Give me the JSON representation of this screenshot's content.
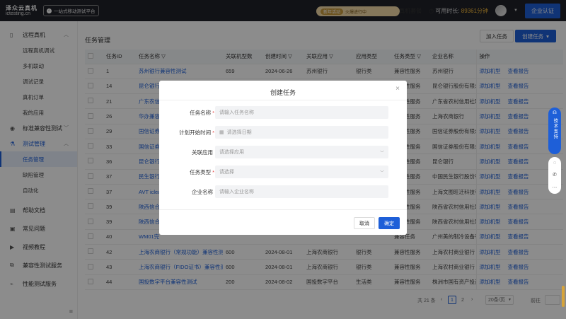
{
  "topbar": {
    "logo_line1": "泽众云真机",
    "logo_line2": "ictesting.cn",
    "slogan": "一站式移动测试平台",
    "promo_tag": "新年活动",
    "promo_text": "火爆进行中",
    "real_device_cloud": "真机套餐",
    "duration_label": "可用时长:",
    "duration_value": "89361分钟",
    "enterprise_cert": "企业认证"
  },
  "sidebar": {
    "groups": [
      {
        "label": "远程真机",
        "items": [
          "远程真机调试",
          "多机联动",
          "调试记录",
          "真机订单",
          "我的应用"
        ]
      },
      {
        "label": "标准兼容性测试"
      },
      {
        "label": "测试管理",
        "items": [
          "任务管理",
          "缺陷管理",
          "自动化"
        ]
      },
      {
        "label": "帮助文档"
      },
      {
        "label": "常见问题"
      },
      {
        "label": "视频教程"
      },
      {
        "label": "兼容性测试服务"
      },
      {
        "label": "性能测试服务"
      }
    ]
  },
  "main": {
    "title": "任务管理",
    "add_task": "加入任务",
    "create_task": "创建任务",
    "columns": [
      "任务ID",
      "任务名称",
      "关联机型数",
      "创建时间",
      "关联应用",
      "应用类型",
      "任务类型",
      "企业名称",
      "操作"
    ],
    "op_add": "添加机型",
    "op_view": "查看报告",
    "rows": [
      {
        "id": "1",
        "name": "苏州银行兼容性测试",
        "count": "659",
        "date": "2024-06-26",
        "app": "苏州银行",
        "apptype": "银行类",
        "tasktype": "兼容性服务",
        "company": "苏州银行"
      },
      {
        "id": "14",
        "name": "昆仑银行",
        "count": "",
        "date": "",
        "app": "",
        "apptype": "",
        "tasktype": "兼容性服务",
        "company": "昆仑银行股份有限公"
      },
      {
        "id": "21",
        "name": "广东农信",
        "count": "",
        "date": "",
        "app": "",
        "apptype": "",
        "tasktype": "兼容性服务",
        "company": "广东省农村信用社联"
      },
      {
        "id": "26",
        "name": "华办兼容性",
        "count": "",
        "date": "",
        "app": "",
        "apptype": "",
        "tasktype": "兼容性服务",
        "company": "上海农商银行"
      },
      {
        "id": "29",
        "name": "国信证券",
        "count": "",
        "date": "",
        "app": "",
        "apptype": "",
        "tasktype": "兼容性服务",
        "company": "国信证券股份有限公"
      },
      {
        "id": "33",
        "name": "国信证券",
        "count": "",
        "date": "",
        "app": "",
        "apptype": "",
        "tasktype": "兼容性服务",
        "company": "国信证券股份有限公"
      },
      {
        "id": "36",
        "name": "昆仑银行",
        "count": "",
        "date": "",
        "app": "",
        "apptype": "",
        "tasktype": "兼容性服务",
        "company": "昆仑银行"
      },
      {
        "id": "37",
        "name": "民生银行",
        "count": "",
        "date": "",
        "app": "",
        "apptype": "",
        "tasktype": "兼容性服务",
        "company": "中国民生银行股份有"
      },
      {
        "id": "37",
        "name": "AVT iclea",
        "count": "",
        "date": "",
        "app": "",
        "apptype": "",
        "tasktype": "兼容性服务",
        "company": "上海文图旺迁科技有"
      },
      {
        "id": "39",
        "name": "陕西信合",
        "count": "",
        "date": "",
        "app": "",
        "apptype": "",
        "tasktype": "兼容性服务",
        "company": "陕西省农村信用社联"
      },
      {
        "id": "39",
        "name": "陕西信合",
        "count": "",
        "date": "",
        "app": "",
        "apptype": "",
        "tasktype": "兼容性服务",
        "company": "陕西省农村信用社联"
      },
      {
        "id": "40",
        "name": "WM01完",
        "count": "",
        "date": "",
        "app": "",
        "apptype": "",
        "tasktype": "兼容任务",
        "company": "广州美的制冷设备有"
      },
      {
        "id": "42",
        "name": "上海农商银行（常规功能）兼容性测",
        "count": "600",
        "date": "2024-08-01",
        "app": "上海农商银行",
        "apptype": "银行类",
        "tasktype": "兼容性服务",
        "company": "上海农村商业银行"
      },
      {
        "id": "43",
        "name": "上海农商银行（FIDO证书）兼容性测",
        "count": "600",
        "date": "2024-08-01",
        "app": "上海农商银行",
        "apptype": "银行类",
        "tasktype": "兼容性服务",
        "company": "上海农村商业银行"
      },
      {
        "id": "44",
        "name": "国投数字平台兼容性测试",
        "count": "200",
        "date": "2024-08-02",
        "app": "国投数字平台",
        "apptype": "生活类",
        "tasktype": "兼容性服务",
        "company": "株洲市国有资产投资"
      }
    ],
    "pager": {
      "total": "共 21 条",
      "page1": "1",
      "page2": "2",
      "per_page": "20条/页",
      "goto": "前往"
    }
  },
  "modal": {
    "title": "创建任务",
    "fields": [
      {
        "label": "任务名称",
        "required": "*",
        "placeholder": "请输入任务名称"
      },
      {
        "label": "计划开始时间",
        "required": "*",
        "placeholder": "请选择日期"
      },
      {
        "label": "关联应用",
        "required": "",
        "placeholder": "请选择应用"
      },
      {
        "label": "任务类型",
        "required": "*",
        "placeholder": "请选择"
      },
      {
        "label": "企业名称",
        "required": "",
        "placeholder": "请输入企业名称"
      }
    ],
    "cancel": "取消",
    "confirm": "确定"
  },
  "float": {
    "support": "技术支持"
  }
}
